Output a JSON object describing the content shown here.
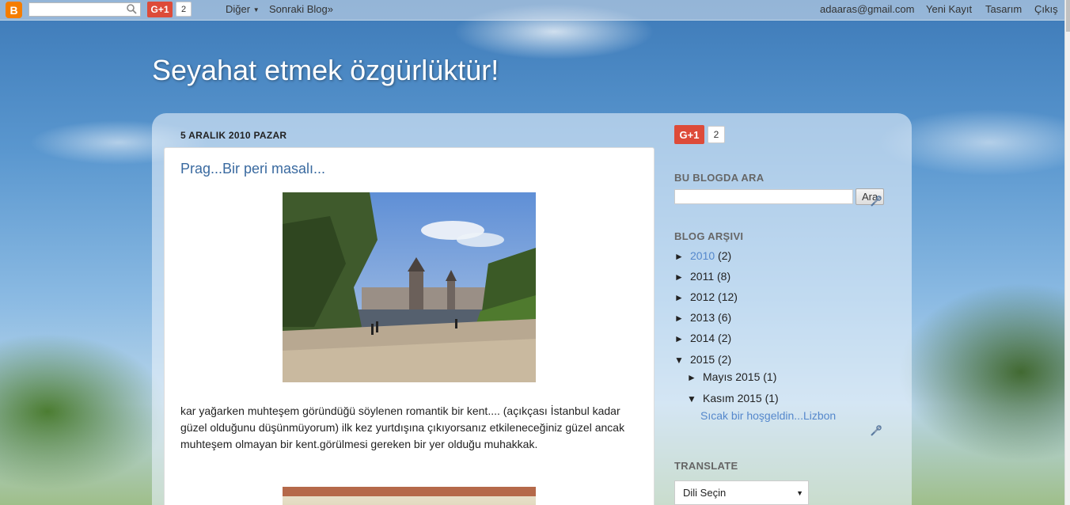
{
  "navbar": {
    "logo": "B",
    "search_placeholder": "",
    "search_icon": "search-icon",
    "gplus_label": "G+1",
    "gplus_count": "2",
    "more_label": "Diğer",
    "next_blog_label": "Sonraki Blog»",
    "email": "adaaras@gmail.com",
    "new_post_label": "Yeni Kayıt",
    "design_label": "Tasarım",
    "logout_label": "Çıkış"
  },
  "header": {
    "title": "Seyahat etmek özgürlüktür!"
  },
  "post": {
    "date": "5 ARALIK 2010 PAZAR",
    "title": "Prag...Bir peri masalı...",
    "body": "kar yağarken muhteşem göründüğü söylenen romantik bir kent.... (açıkçası İstanbul kadar güzel olduğunu düşünmüyorum) ilk kez yurtdışına çıkıyorsanız etkileneceğiniz güzel ancak muhteşem olmayan bir kent.görülmesi gereken bir yer olduğu muhakkak."
  },
  "sidebar": {
    "gplus_label": "G+1",
    "gplus_count": "2",
    "search": {
      "title": "BU BLOGDA ARA",
      "button": "Ara",
      "placeholder": ""
    },
    "archive": {
      "title": "BLOG ARŞIVI",
      "years": [
        {
          "year": "2010",
          "count": "(2)",
          "toggle": "►",
          "is_link": true
        },
        {
          "year": "2011",
          "count": "(8)",
          "toggle": "►"
        },
        {
          "year": "2012",
          "count": "(12)",
          "toggle": "►"
        },
        {
          "year": "2013",
          "count": "(6)",
          "toggle": "►"
        },
        {
          "year": "2014",
          "count": "(2)",
          "toggle": "►"
        },
        {
          "year": "2015",
          "count": "(2)",
          "toggle": "▼"
        }
      ],
      "months": [
        {
          "month": "Mayıs 2015",
          "count": "(1)",
          "toggle": "►"
        },
        {
          "month": "Kasım 2015",
          "count": "(1)",
          "toggle": "▼"
        }
      ],
      "post_link": "Sıcak bir hoşgeldin...Lizbon"
    },
    "translate": {
      "title": "TRANSLATE",
      "select_value": "Dili Seçin"
    }
  }
}
